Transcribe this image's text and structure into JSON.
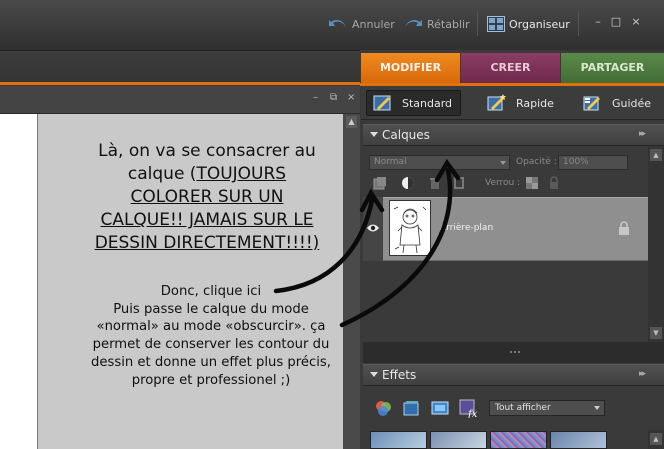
{
  "titlebar": {
    "undo_label": "Annuler",
    "redo_label": "Rétablir",
    "organiser_label": "Organiseur",
    "minimize": "–",
    "maximize": "□",
    "close": "×"
  },
  "mode_tabs": {
    "modifier": "MODIFIER",
    "creer": "CREER",
    "partager": "PARTAGER"
  },
  "edit_modes": {
    "standard": "Standard",
    "rapide": "Rapide",
    "guidee": "Guidée"
  },
  "document": {
    "minimize": "–",
    "restore": "⧉",
    "close": "×",
    "note_big": {
      "line1": "Là, on va se consacrer au",
      "line2a": "calque (",
      "line2b": "TOUJOURS",
      "line3": "COLORER SUR UN",
      "line4": "CALQUE!! JAMAIS SUR LE",
      "line5": "DESSIN DIRECTEMENT!!!!)"
    },
    "note_small": {
      "line1": "Donc, clique ici",
      "line2": "Puis passe le calque du mode",
      "line3": "«normal» au mode «obscurcir». ça",
      "line4": "permet de conserver les contour du",
      "line5": "dessin et donne un effet plus précis,",
      "line6": "propre et professionel ;)"
    }
  },
  "layers_panel": {
    "title": "Calques",
    "more": "▸▸",
    "blend_mode": "Normal",
    "opacity_label": "Opacité :",
    "opacity_value": "100%",
    "lock_label": "Verrou :",
    "layer_name": "Arrière-plan"
  },
  "effects_panel": {
    "title": "Effets",
    "more": "▸▸",
    "filter_select": "Tout afficher"
  },
  "colors": {
    "orange_accent": "#e2700e",
    "creer_tab": "#7a3256",
    "partager_tab": "#4f7c40"
  }
}
